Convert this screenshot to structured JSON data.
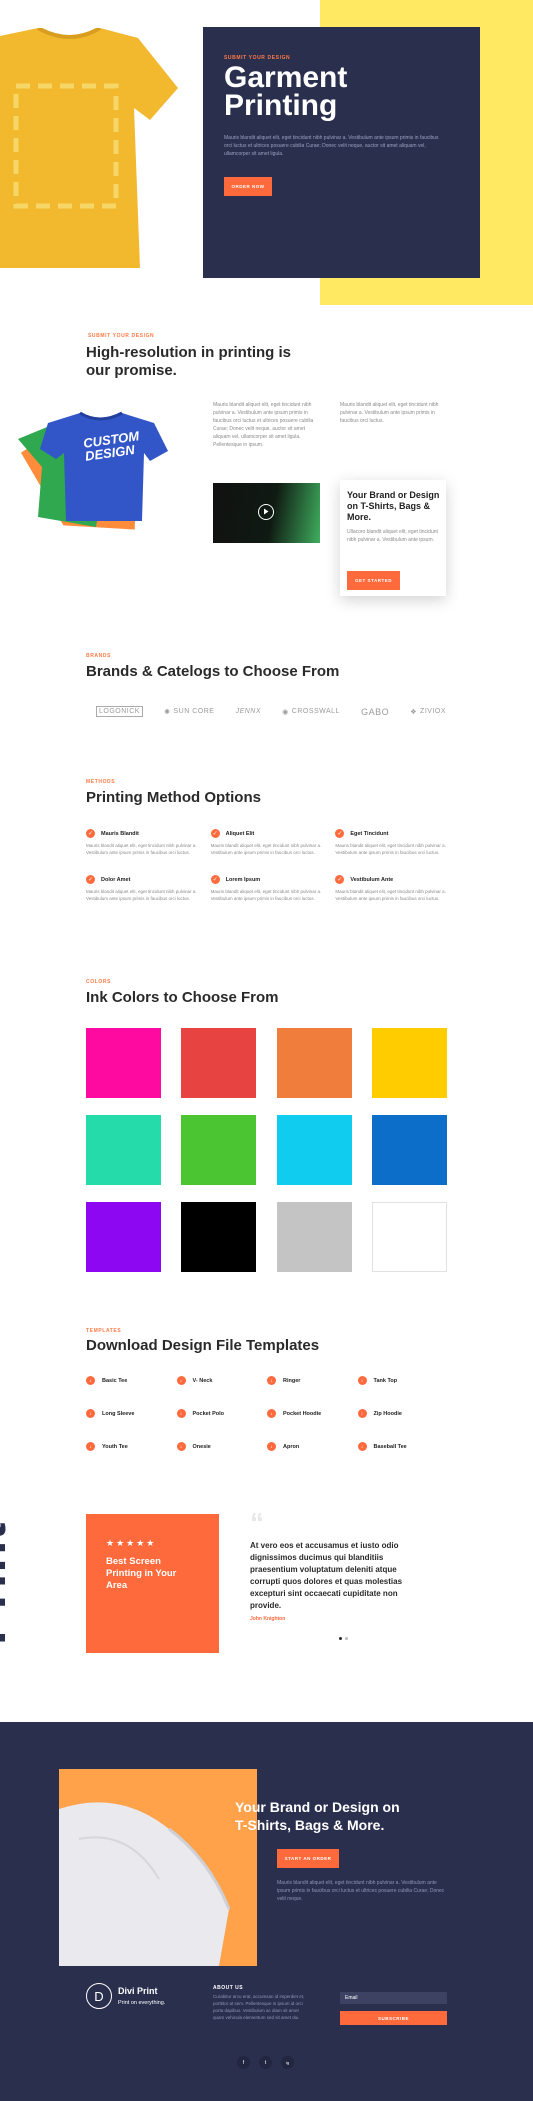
{
  "hero": {
    "kicker": "Submit your design",
    "title_line1": "Garment",
    "title_line2": "Printing",
    "description": "Mauris blandit aliquet elit, eget tincidunt nibh pulvinar a. Vestibulum ante ipsum primis in faucibus orci luctus et ultrices posuere cubilia Curae; Donec velit neque, auctor sit amet aliquam vel, ullamcorper sit amet ligula.",
    "button": "Order Now"
  },
  "promise": {
    "kicker": "Submit your design",
    "title_line1": "High-resolution in printing is",
    "title_line2": "our promise.",
    "shirt_text_line1": "CUSTOM",
    "shirt_text_line2": "DESIGN",
    "col1": "Mauris blandit aliquet elit, eget tincidunt nibh pulvinar a. Vestibulum ante ipsum primis in faucibus orci luctus et ultrices posuere cubilia Curae; Donec velit neque, auctor sit amet aliquam vel, ullamcorper sit amet ligula. Pellentesque in ipsum.",
    "col2": "Mauris blandit aliquet elit, eget tincidunt nibh pulvinar a. Vestibulum ante ipsum primis in faucibus orci luctus.",
    "card_title": "Your Brand or Design on T-Shirts, Bags & More.",
    "card_text": "Ullacoro blandit aliquet elit, eget tincidunt nibh pulvinar a. Vestibulum ante ipsum.",
    "card_button": "Get Started"
  },
  "brands": {
    "kicker": "Brands",
    "title": "Brands & Catelogs to Choose From",
    "logos": [
      "LOGONICK",
      "SUN CORE",
      "JENNX",
      "CROSSWALL",
      "GABO",
      "ZIVIOX"
    ]
  },
  "methods": {
    "kicker": "Methods",
    "title": "Printing Method Options",
    "items": [
      {
        "title": "Mauris Blandit",
        "text": "Mauris blandit aliquet elit, eget tincidunt nibh pulvinar a. Vestibulum ante ipsum primis in faucibus orci luctus."
      },
      {
        "title": "Aliquet Elit",
        "text": "Mauris blandit aliquet elit, eget tincidunt nibh pulvinar a. Vestibulum ante ipsum primis in faucibus orci luctus."
      },
      {
        "title": "Eget Tincidunt",
        "text": "Mauris blandit aliquet elit, eget tincidunt nibh pulvinar a. Vestibulum ante ipsum primis in faucibus orci luctus."
      },
      {
        "title": "Dolor Amet",
        "text": "Mauris blandit aliquet elit, eget tincidunt nibh pulvinar a. Vestibulum ante ipsum primis in faucibus orci luctus."
      },
      {
        "title": "Lorem Ipsum",
        "text": "Mauris blandit aliquet elit, eget tincidunt nibh pulvinar a. Vestibulum ante ipsum primis in faucibus orci luctus."
      },
      {
        "title": "Vestibulum Ante",
        "text": "Mauris blandit aliquet elit, eget tincidunt nibh pulvinar a. Vestibulum ante ipsum primis in faucibus orci luctus."
      }
    ]
  },
  "colors": {
    "kicker": "Colors",
    "title": "Ink Colors to Choose From",
    "swatches": [
      "#ff0aa0",
      "#e74340",
      "#f07d3c",
      "#ffcc00",
      "#25dbaa",
      "#4cc533",
      "#10cdf0",
      "#0c6ec9",
      "#8d07f2",
      "#000000",
      "#c4c4c4",
      "#ffffff"
    ]
  },
  "templates": {
    "kicker": "Templates",
    "title": "Download Design File Templates",
    "items": [
      "Basic Tee",
      "V- Neck",
      "Ringer",
      "Tank Top",
      "Long Sleeve",
      "Pocket Polo",
      "Pocket Hoodie",
      "Zip Hoodie",
      "Youth Tee",
      "Onesie",
      "Apron",
      "Baseball Tee"
    ]
  },
  "testimonial": {
    "stars": "★★★★★",
    "box_title": "Best Screen Printing in Your Area",
    "quote": "At vero eos et accusamus et iusto odio dignissimos ducimus qui blanditiis praesentium voluptatum deleniti atque corrupti quos dolores et quas molestias excepturi sint occaecati cupiditate non provide.",
    "author": "John Knighton",
    "side_word": "Print"
  },
  "cta": {
    "title_line1": "Your Brand or Design on",
    "title_line2": "T-Shirts, Bags & More.",
    "button": "Start an Order",
    "text": "Mauris blandit aliquet elit, eget tincidunt nibh pulvinar a. Vestibulum ante ipsum primis in faucibus orci luctus et ultrices posuere cubilia Curae; Donec velit neque."
  },
  "footer": {
    "brand_initial": "D",
    "brand_name": "Divi Print",
    "tagline": "Print on everything.",
    "about_heading": "About Us",
    "about_text": "Curabitur arcu erat, accumsan id imperdiet et, porttitor at sem. Pellentesque in ipsum id orci porta dapibus. Vestibulum ac diam sit amet quam vehicula elementum sed sit amet dui.",
    "email_placeholder": "Email",
    "subscribe": "Subscribe",
    "social": [
      "f",
      "t",
      "ig"
    ]
  },
  "theme": {
    "accent": "#ff6a3d",
    "navy": "#2a2f4e",
    "yellow": "#ffe862"
  }
}
